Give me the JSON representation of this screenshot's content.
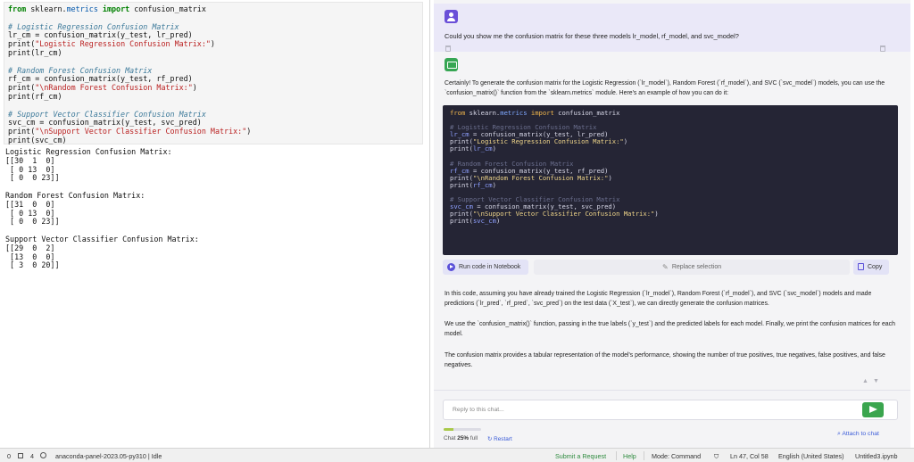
{
  "notebook": {
    "code_lines": [
      [
        [
          "kw",
          "from"
        ],
        [
          "pl",
          " sklearn."
        ],
        [
          "mod",
          "metrics"
        ],
        [
          "pl",
          " "
        ],
        [
          "kw",
          "import"
        ],
        [
          "pl",
          " confusion_matrix"
        ]
      ],
      [
        [
          "pl",
          ""
        ]
      ],
      [
        [
          "cm",
          "# Logistic Regression Confusion Matrix"
        ]
      ],
      [
        [
          "pl",
          "lr_cm = confusion_matrix(y_test, lr_pred)"
        ]
      ],
      [
        [
          "pl",
          "print("
        ],
        [
          "str",
          "\"Logistic Regression Confusion Matrix:\""
        ],
        [
          "pl",
          ")"
        ]
      ],
      [
        [
          "pl",
          "print(lr_cm)"
        ]
      ],
      [
        [
          "pl",
          ""
        ]
      ],
      [
        [
          "cm",
          "# Random Forest Confusion Matrix"
        ]
      ],
      [
        [
          "pl",
          "rf_cm = confusion_matrix(y_test, rf_pred)"
        ]
      ],
      [
        [
          "pl",
          "print("
        ],
        [
          "str",
          "\"\\nRandom Forest Confusion Matrix:\""
        ],
        [
          "pl",
          ")"
        ]
      ],
      [
        [
          "pl",
          "print(rf_cm)"
        ]
      ],
      [
        [
          "pl",
          ""
        ]
      ],
      [
        [
          "cm",
          "# Support Vector Classifier Confusion Matrix"
        ]
      ],
      [
        [
          "pl",
          "svc_cm = confusion_matrix(y_test, svc_pred)"
        ]
      ],
      [
        [
          "pl",
          "print("
        ],
        [
          "str",
          "\"\\nSupport Vector Classifier Confusion Matrix:\""
        ],
        [
          "pl",
          ")"
        ]
      ],
      [
        [
          "pl",
          "print(svc_cm)"
        ]
      ]
    ],
    "output_text": "Logistic Regression Confusion Matrix:\n[[30  1  0]\n [ 0 13  0]\n [ 0  0 23]]\n\nRandom Forest Confusion Matrix:\n[[31  0  0]\n [ 0 13  0]\n [ 0  0 23]]\n\nSupport Vector Classifier Confusion Matrix:\n[[29  0  2]\n [13  0  0]\n [ 3  0 20]]"
  },
  "chat": {
    "user_message": "Could you show me the confusion matrix for these three models lr_model, rf_model, and svc_model?",
    "bot_intro": "Certainly! To generate the confusion matrix for the Logistic Regression (`lr_model`), Random Forest (`rf_model`), and SVC (`svc_model`) models, you can use the `confusion_matrix()` function from the `sklearn.metrics` module. Here's an example of how you can do it:",
    "code_lines": [
      [
        [
          "kw",
          "from"
        ],
        [
          "pl",
          " sklearn."
        ],
        [
          "mod",
          "metrics"
        ],
        [
          "pl",
          " "
        ],
        [
          "kw",
          "import"
        ],
        [
          "pl",
          " confusion_matrix"
        ]
      ],
      [
        [
          "pl",
          ""
        ]
      ],
      [
        [
          "cm",
          "# Logistic Regression Confusion Matrix"
        ]
      ],
      [
        [
          "var",
          "lr_cm"
        ],
        [
          "pl",
          " = confusion_matrix(y_test, lr_pred)"
        ]
      ],
      [
        [
          "pl",
          "print("
        ],
        [
          "str",
          "\"Logistic Regression Confusion Matrix:\""
        ],
        [
          "pl",
          ")"
        ]
      ],
      [
        [
          "pl",
          "print("
        ],
        [
          "var",
          "lr_cm"
        ],
        [
          "pl",
          ")"
        ]
      ],
      [
        [
          "pl",
          ""
        ]
      ],
      [
        [
          "cm",
          "# Random Forest Confusion Matrix"
        ]
      ],
      [
        [
          "var",
          "rf_cm"
        ],
        [
          "pl",
          " = confusion_matrix(y_test, rf_pred)"
        ]
      ],
      [
        [
          "pl",
          "print("
        ],
        [
          "str",
          "\"\\nRandom Forest Confusion Matrix:\""
        ],
        [
          "pl",
          ")"
        ]
      ],
      [
        [
          "pl",
          "print("
        ],
        [
          "var",
          "rf_cm"
        ],
        [
          "pl",
          ")"
        ]
      ],
      [
        [
          "pl",
          ""
        ]
      ],
      [
        [
          "cm",
          "# Support Vector Classifier Confusion Matrix"
        ]
      ],
      [
        [
          "var",
          "svc_cm"
        ],
        [
          "pl",
          " = confusion_matrix(y_test, svc_pred)"
        ]
      ],
      [
        [
          "pl",
          "print("
        ],
        [
          "str",
          "\"\\nSupport Vector Classifier Confusion Matrix:\""
        ],
        [
          "pl",
          ")"
        ]
      ],
      [
        [
          "pl",
          "print("
        ],
        [
          "var",
          "svc_cm"
        ],
        [
          "pl",
          ")"
        ]
      ]
    ],
    "run_label": "Run code in Notebook",
    "replace_label": "Replace selection",
    "copy_label": "Copy",
    "bot_para2": "In this code, assuming you have already trained the Logistic Regression (`lr_model`), Random Forest (`rf_model`), and SVC (`svc_model`) models and made predictions (`lr_pred`, `rf_pred`, `svc_pred`) on the test data (`X_test`), we can directly generate the confusion matrices.",
    "bot_para3": "We use the `confusion_matrix()` function, passing in the true labels (`y_test`) and the predicted labels for each model. Finally, we print the confusion matrices for each model.",
    "bot_para4": "The confusion matrix provides a tabular representation of the model's performance, showing the number of true positives, true negatives, false positives, and false negatives.",
    "input_placeholder": "Reply to this chat...",
    "chat_usage_label": "Chat",
    "chat_usage_value": "25%",
    "chat_usage_suffix": "full",
    "usage_fraction": 0.25,
    "restart_label": "Restart",
    "attach_label": "Attach to chat"
  },
  "status_bar": {
    "count_a": "0",
    "count_b": "4",
    "kernel": "anaconda-panel-2023.05-py310 | Idle",
    "submit_request": "Submit a Request",
    "help": "Help",
    "mode": "Mode: Command",
    "position": "Ln 47, Col 58",
    "language": "English (United States)",
    "filename": "Untitled3.ipynb"
  },
  "colors": {
    "accent_purple": "#6a4fd8",
    "accent_green": "#36a653",
    "link_blue": "#3a5bd8"
  }
}
